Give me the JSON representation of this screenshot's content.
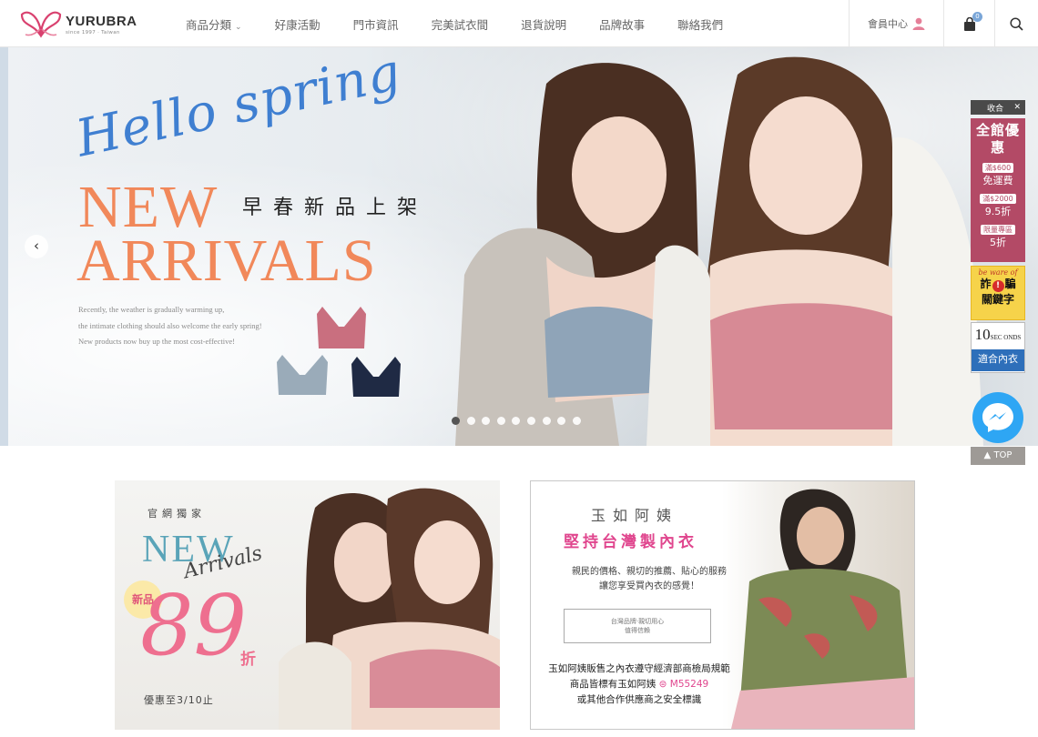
{
  "brand": {
    "name": "YURUBRA",
    "sub": "since 1997 · Taiwan",
    "color": "#d9416f"
  },
  "nav": {
    "items": [
      {
        "label": "商品分類",
        "has_dropdown": true
      },
      {
        "label": "好康活動"
      },
      {
        "label": "門市資訊"
      },
      {
        "label": "完美試衣間"
      },
      {
        "label": "退貨說明"
      },
      {
        "label": "品牌故事"
      },
      {
        "label": "聯絡我們"
      }
    ],
    "member_label": "會員中心",
    "cart_count": "0",
    "icons": [
      "user-icon",
      "bag-icon",
      "search-icon"
    ]
  },
  "hero": {
    "script_text": "Hello spring",
    "title_line1": "NEW",
    "title_line2": "ARRIVALS",
    "tagline": "早春新品上架",
    "desc_lines": [
      "Recently, the weather is gradually warming up,",
      "the intimate clothing should also welcome the early spring!",
      "New products now buy up the most cost-effective!"
    ],
    "accent_color": "#f1885a",
    "script_color": "#3f7fd1",
    "slide_count": 9,
    "active_slide": 1
  },
  "side": {
    "collapse_label": "收合",
    "promo": {
      "title": "全館優惠",
      "items": [
        {
          "tag": "滿$600",
          "value": "免運費"
        },
        {
          "tag": "滿$2000",
          "value": "9.5折"
        },
        {
          "tag": "限量專區",
          "value": "5折"
        }
      ]
    },
    "fraud": {
      "top": "be ware of",
      "mid_a": "詐",
      "mid_b": "騙",
      "bottom": "關鍵字"
    },
    "sec": {
      "num": "10",
      "unit": "SEC ONDS",
      "label": "適合內衣"
    },
    "top_label": "TOP"
  },
  "card_left": {
    "exclusive": "官網獨家",
    "new": "NEW",
    "arrivals": "Arrivals",
    "badge": "新品",
    "discount": "89",
    "off": "折",
    "until": "優惠至3/10止"
  },
  "card_right": {
    "name": "玉如阿姨",
    "slogan": "堅持台灣製內衣",
    "p1_line1": "親民的價格、親切的推薦、貼心的服務",
    "p1_line2": "讓您享受買內衣的感覺！",
    "box_line1": "台灣品牌·親切用心",
    "box_line2": "值得信賴",
    "p2_line1": "玉如阿姨販售之內衣遵守經濟部商檢局規範",
    "p2_line2a": "商品皆標有玉如阿姨",
    "p2_mark": "M55249",
    "p2_line3": "或其他合作供應商之安全標識"
  }
}
